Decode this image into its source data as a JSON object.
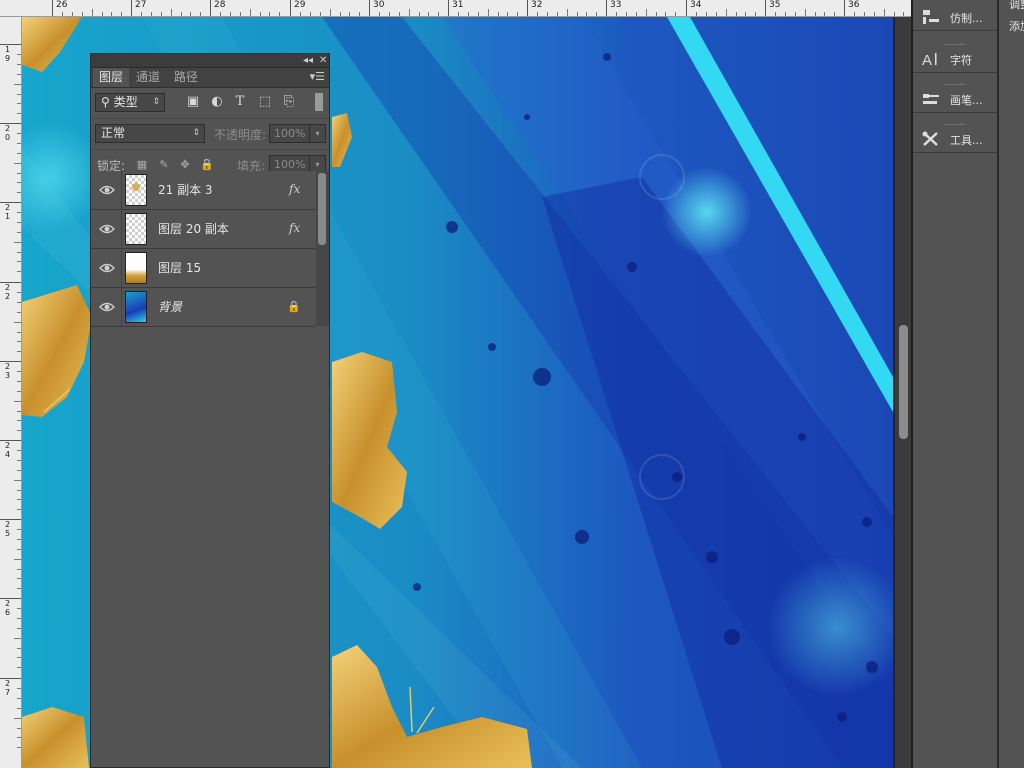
{
  "ruler": {
    "top_labels": [
      "26",
      "27",
      "28",
      "29",
      "30",
      "31",
      "32",
      "33",
      "34",
      "35",
      "36"
    ],
    "left_labels": [
      [
        "1",
        "9"
      ],
      [
        "2",
        "0"
      ],
      [
        "2",
        "1"
      ],
      [
        "2",
        "2"
      ],
      [
        "2",
        "3"
      ],
      [
        "2",
        "4"
      ],
      [
        "2",
        "5"
      ],
      [
        "2",
        "6"
      ],
      [
        "2",
        "7"
      ]
    ]
  },
  "layers_panel": {
    "collapse_icon": "double-chevron-left-icon",
    "close_icon": "close-icon",
    "menu_icon": "panel-menu-icon",
    "tabs": [
      {
        "label": "图层",
        "active": true
      },
      {
        "label": "通道",
        "active": false
      },
      {
        "label": "路径",
        "active": false
      }
    ],
    "filter": {
      "kind_label": "类型",
      "icons": [
        "pixel-filter-icon",
        "adjustment-filter-icon",
        "type-filter-icon",
        "shape-filter-icon",
        "smart-object-filter-icon"
      ],
      "toggle_icon": "filter-toggle-icon"
    },
    "blend": {
      "mode": "正常",
      "opacity_label": "不透明度:",
      "opacity_value": "100%"
    },
    "lock": {
      "label": "锁定:",
      "icons": [
        "lock-transparent-icon",
        "lock-brush-icon",
        "lock-move-icon",
        "lock-all-icon"
      ],
      "fill_label": "填充:",
      "fill_value": "100%"
    },
    "layers": [
      {
        "name": "21 副本 3",
        "fx": "fx",
        "visible": true,
        "thumb": "checker-gold"
      },
      {
        "name": "图层 20 副本",
        "fx": "fx",
        "visible": true,
        "thumb": "checker"
      },
      {
        "name": "图层 15",
        "fx": "",
        "visible": true,
        "thumb": "gold"
      },
      {
        "name": "背景",
        "fx": "",
        "visible": true,
        "thumb": "blue",
        "locked": true
      }
    ]
  },
  "dock": {
    "items": [
      {
        "label": "仿制...",
        "icon": "clone-source-icon"
      },
      {
        "label": "字符",
        "icon": "character-icon"
      },
      {
        "label": "画笔...",
        "icon": "brush-presets-icon"
      },
      {
        "label": "工具...",
        "icon": "tool-presets-icon"
      }
    ]
  },
  "far_right": {
    "line1": "调整",
    "line2": "添加"
  },
  "colors": {
    "canvas_cyan": "#1aa0c8",
    "canvas_deep_blue": "#1838b8",
    "gold": "#d4a23a",
    "panel_bg": "#535353"
  }
}
